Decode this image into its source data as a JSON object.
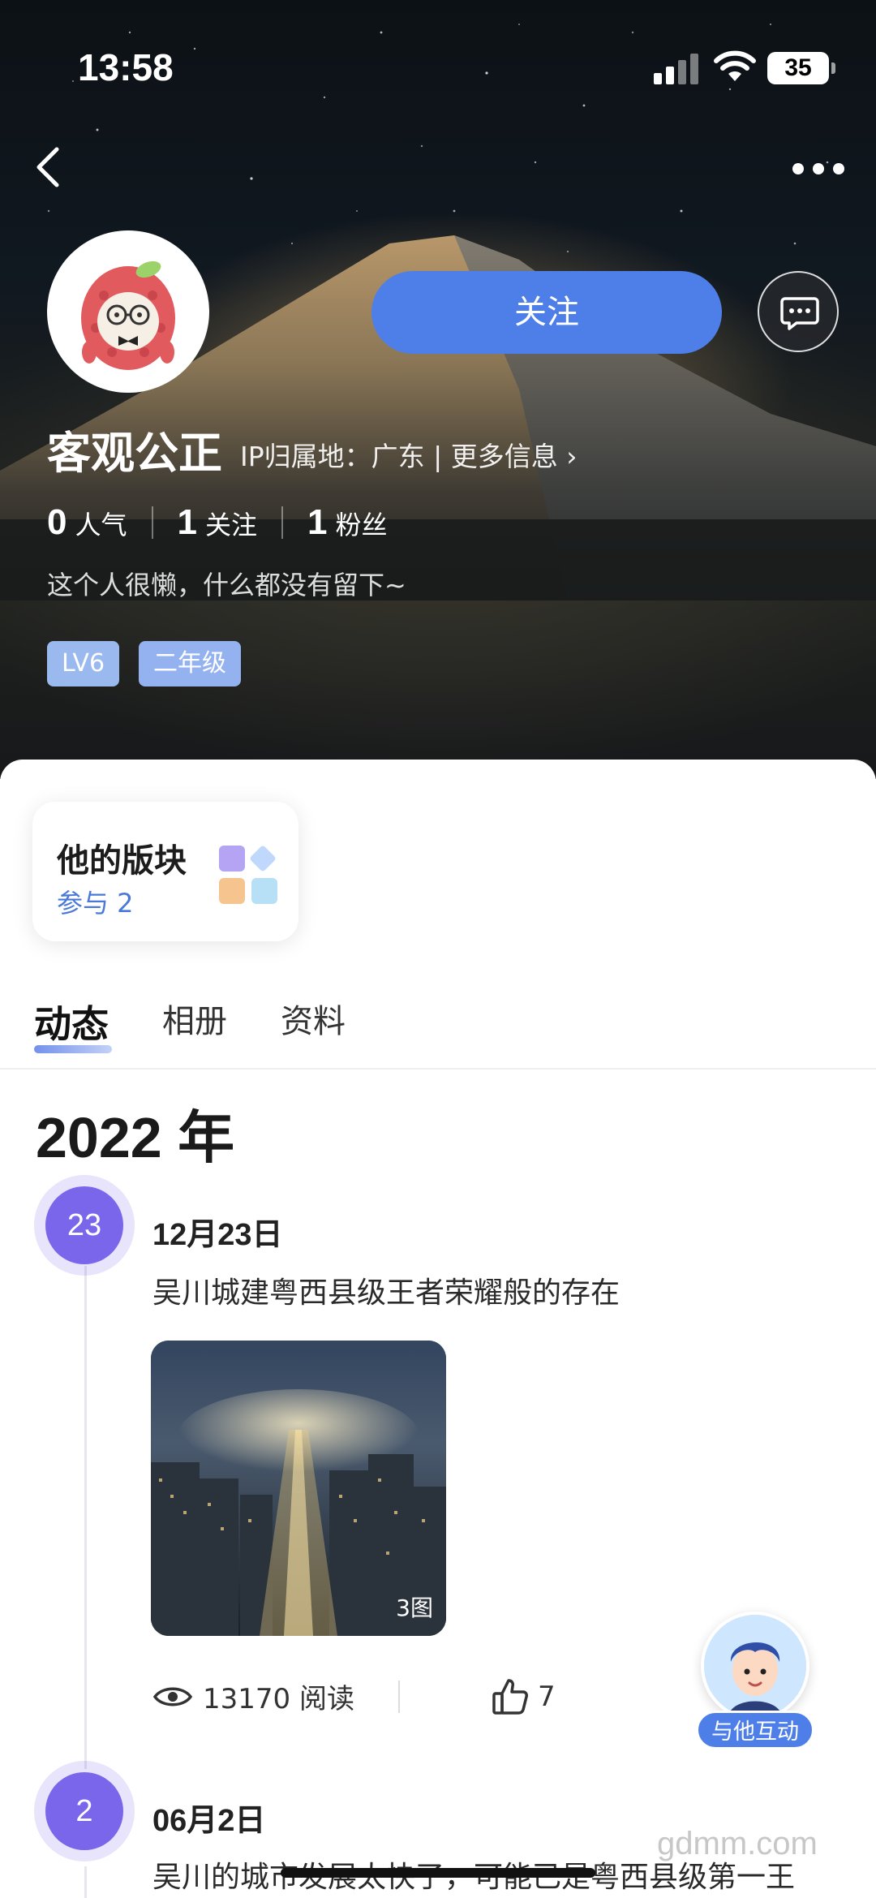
{
  "status_bar": {
    "time": "13:58",
    "battery": "35"
  },
  "profile": {
    "name": "客观公正",
    "ip_info": "IP归属地：广东 | 更多信息 ›",
    "follow_label": "关注",
    "stats": [
      {
        "num": "0",
        "label": "人气"
      },
      {
        "num": "1",
        "label": "关注"
      },
      {
        "num": "1",
        "label": "粉丝"
      }
    ],
    "bio": "这个人很懒，什么都没有留下~",
    "badges": [
      "LV6",
      "二年级"
    ]
  },
  "sections_card": {
    "title": "他的版块",
    "subtitle": "参与 2"
  },
  "tabs": [
    "动态",
    "相册",
    "资料"
  ],
  "year": "2022 年",
  "posts": [
    {
      "day": "23",
      "date": "12月23日",
      "text": "吴川城建粤西县级王者荣耀般的存在",
      "image_count": "3图",
      "reads": "13170 阅读",
      "likes": "7"
    },
    {
      "day": "2",
      "date": "06月2日",
      "text": "吴川的城市发展太快了，可能已是粤西县级第一王"
    }
  ],
  "interact_label": "与他互动",
  "watermark": "gdmm.com",
  "icons": {
    "back": "back-icon",
    "more": "more-icon",
    "message": "message-icon",
    "sections": "sections-grid-icon",
    "eye": "eye-icon",
    "like": "thumbs-up-icon"
  },
  "colors": {
    "accent": "#4e7fe8",
    "timeline_dot": "#7a66ea"
  }
}
